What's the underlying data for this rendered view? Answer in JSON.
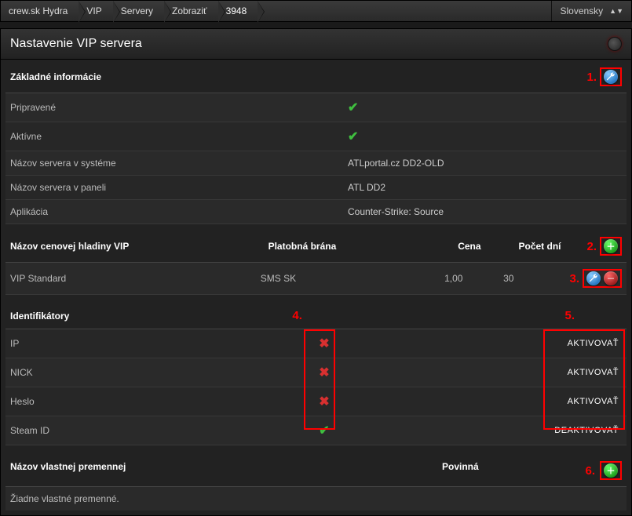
{
  "breadcrumb": [
    "crew.sk Hydra",
    "VIP",
    "Servery",
    "Zobraziť",
    "3948"
  ],
  "language": "Slovensky",
  "panel_title": "Nastavenie VIP servera",
  "basic_info": {
    "header": "Základné informácie",
    "rows": [
      {
        "label": "Pripravené",
        "check": true
      },
      {
        "label": "Aktívne",
        "check": true
      },
      {
        "label": "Názov servera v systéme",
        "value": "ATLportal.cz DD2-OLD"
      },
      {
        "label": "Názov servera v paneli",
        "value": "ATL DD2"
      },
      {
        "label": "Aplikácia",
        "value": "Counter-Strike: Source"
      }
    ]
  },
  "pricing": {
    "headers": {
      "name": "Názov cenovej hladiny VIP",
      "gate": "Platobná brána",
      "price": "Cena",
      "days": "Počet dní"
    },
    "rows": [
      {
        "name": "VIP Standard",
        "gate": "SMS SK",
        "price": "1,00",
        "days": "30"
      }
    ]
  },
  "identifiers": {
    "header": "Identifikátory",
    "rows": [
      {
        "name": "IP",
        "active": false,
        "action": "AKTIVOVAŤ"
      },
      {
        "name": "NICK",
        "active": false,
        "action": "AKTIVOVAŤ"
      },
      {
        "name": "Heslo",
        "active": false,
        "action": "AKTIVOVAŤ"
      },
      {
        "name": "Steam ID",
        "active": true,
        "action": "DEAKTIVOVAŤ"
      }
    ]
  },
  "custom_vars": {
    "headers": {
      "name": "Názov vlastnej premennej",
      "required": "Povinná"
    },
    "empty": "Žiadne vlastné premenné."
  },
  "callouts": {
    "c1": "1.",
    "c2": "2.",
    "c3": "3.",
    "c4": "4.",
    "c5": "5.",
    "c6": "6."
  }
}
